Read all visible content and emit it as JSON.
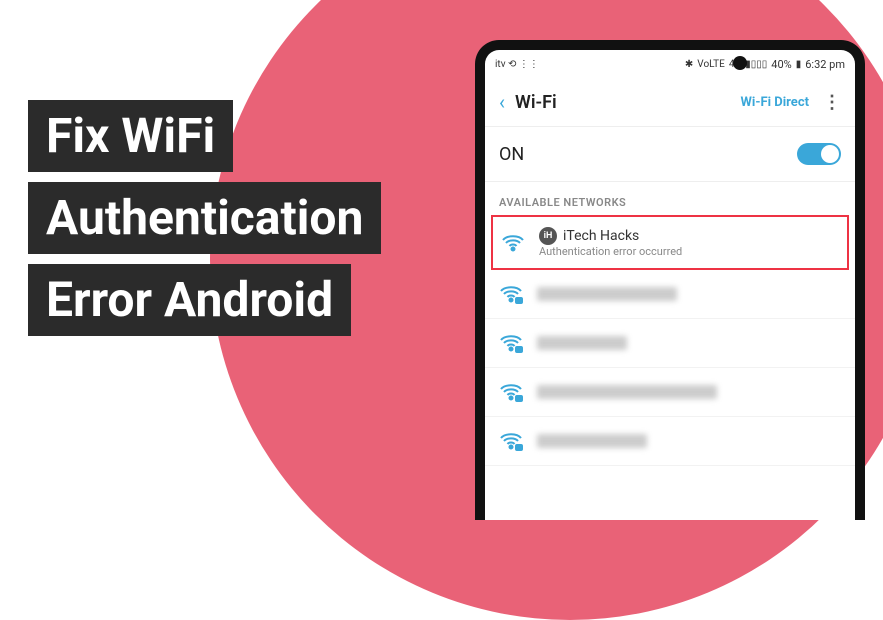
{
  "headline": {
    "line1": "Fix WiFi",
    "line2": "Authentication",
    "line3": "Error Android"
  },
  "status_bar": {
    "left_icons": "itv  ⟲  ⋮⋮",
    "bt_icon": "✱",
    "volte": "VoLTE",
    "signal": "4G",
    "signal_bars": "▮▯▯▯",
    "battery_pct": "40%",
    "battery_icon": "▮",
    "time": "6:32 pm"
  },
  "wifi_screen": {
    "back": "‹",
    "title": "Wi-Fi",
    "direct": "Wi-Fi Direct",
    "more": "⋮",
    "on_label": "ON",
    "section": "AVAILABLE NETWORKS"
  },
  "networks": {
    "highlighted": {
      "badge": "iH",
      "name": "iTech Hacks",
      "sub": "Authentication error occurred"
    }
  }
}
